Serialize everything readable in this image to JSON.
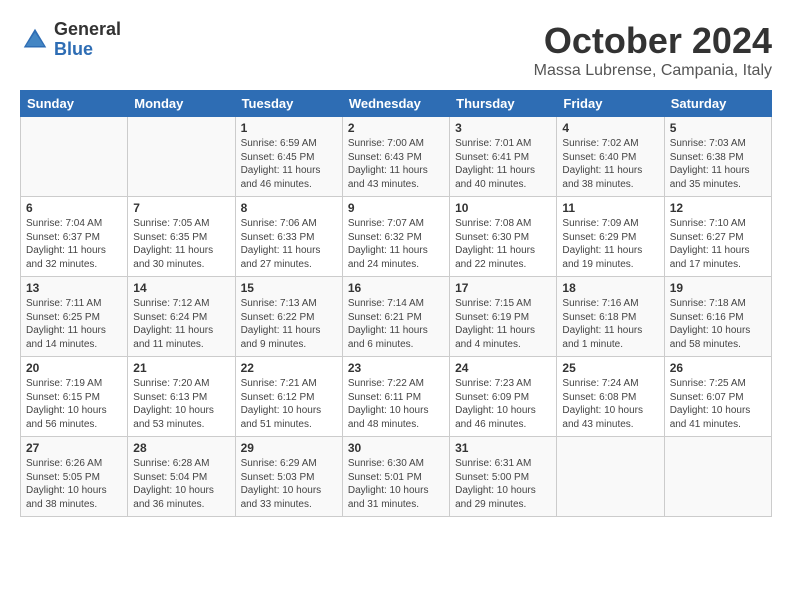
{
  "header": {
    "logo_general": "General",
    "logo_blue": "Blue",
    "title": "October 2024",
    "location": "Massa Lubrense, Campania, Italy"
  },
  "columns": [
    "Sunday",
    "Monday",
    "Tuesday",
    "Wednesday",
    "Thursday",
    "Friday",
    "Saturday"
  ],
  "weeks": [
    [
      {
        "day": "",
        "info": ""
      },
      {
        "day": "",
        "info": ""
      },
      {
        "day": "1",
        "info": "Sunrise: 6:59 AM\nSunset: 6:45 PM\nDaylight: 11 hours and 46 minutes."
      },
      {
        "day": "2",
        "info": "Sunrise: 7:00 AM\nSunset: 6:43 PM\nDaylight: 11 hours and 43 minutes."
      },
      {
        "day": "3",
        "info": "Sunrise: 7:01 AM\nSunset: 6:41 PM\nDaylight: 11 hours and 40 minutes."
      },
      {
        "day": "4",
        "info": "Sunrise: 7:02 AM\nSunset: 6:40 PM\nDaylight: 11 hours and 38 minutes."
      },
      {
        "day": "5",
        "info": "Sunrise: 7:03 AM\nSunset: 6:38 PM\nDaylight: 11 hours and 35 minutes."
      }
    ],
    [
      {
        "day": "6",
        "info": "Sunrise: 7:04 AM\nSunset: 6:37 PM\nDaylight: 11 hours and 32 minutes."
      },
      {
        "day": "7",
        "info": "Sunrise: 7:05 AM\nSunset: 6:35 PM\nDaylight: 11 hours and 30 minutes."
      },
      {
        "day": "8",
        "info": "Sunrise: 7:06 AM\nSunset: 6:33 PM\nDaylight: 11 hours and 27 minutes."
      },
      {
        "day": "9",
        "info": "Sunrise: 7:07 AM\nSunset: 6:32 PM\nDaylight: 11 hours and 24 minutes."
      },
      {
        "day": "10",
        "info": "Sunrise: 7:08 AM\nSunset: 6:30 PM\nDaylight: 11 hours and 22 minutes."
      },
      {
        "day": "11",
        "info": "Sunrise: 7:09 AM\nSunset: 6:29 PM\nDaylight: 11 hours and 19 minutes."
      },
      {
        "day": "12",
        "info": "Sunrise: 7:10 AM\nSunset: 6:27 PM\nDaylight: 11 hours and 17 minutes."
      }
    ],
    [
      {
        "day": "13",
        "info": "Sunrise: 7:11 AM\nSunset: 6:25 PM\nDaylight: 11 hours and 14 minutes."
      },
      {
        "day": "14",
        "info": "Sunrise: 7:12 AM\nSunset: 6:24 PM\nDaylight: 11 hours and 11 minutes."
      },
      {
        "day": "15",
        "info": "Sunrise: 7:13 AM\nSunset: 6:22 PM\nDaylight: 11 hours and 9 minutes."
      },
      {
        "day": "16",
        "info": "Sunrise: 7:14 AM\nSunset: 6:21 PM\nDaylight: 11 hours and 6 minutes."
      },
      {
        "day": "17",
        "info": "Sunrise: 7:15 AM\nSunset: 6:19 PM\nDaylight: 11 hours and 4 minutes."
      },
      {
        "day": "18",
        "info": "Sunrise: 7:16 AM\nSunset: 6:18 PM\nDaylight: 11 hours and 1 minute."
      },
      {
        "day": "19",
        "info": "Sunrise: 7:18 AM\nSunset: 6:16 PM\nDaylight: 10 hours and 58 minutes."
      }
    ],
    [
      {
        "day": "20",
        "info": "Sunrise: 7:19 AM\nSunset: 6:15 PM\nDaylight: 10 hours and 56 minutes."
      },
      {
        "day": "21",
        "info": "Sunrise: 7:20 AM\nSunset: 6:13 PM\nDaylight: 10 hours and 53 minutes."
      },
      {
        "day": "22",
        "info": "Sunrise: 7:21 AM\nSunset: 6:12 PM\nDaylight: 10 hours and 51 minutes."
      },
      {
        "day": "23",
        "info": "Sunrise: 7:22 AM\nSunset: 6:11 PM\nDaylight: 10 hours and 48 minutes."
      },
      {
        "day": "24",
        "info": "Sunrise: 7:23 AM\nSunset: 6:09 PM\nDaylight: 10 hours and 46 minutes."
      },
      {
        "day": "25",
        "info": "Sunrise: 7:24 AM\nSunset: 6:08 PM\nDaylight: 10 hours and 43 minutes."
      },
      {
        "day": "26",
        "info": "Sunrise: 7:25 AM\nSunset: 6:07 PM\nDaylight: 10 hours and 41 minutes."
      }
    ],
    [
      {
        "day": "27",
        "info": "Sunrise: 6:26 AM\nSunset: 5:05 PM\nDaylight: 10 hours and 38 minutes."
      },
      {
        "day": "28",
        "info": "Sunrise: 6:28 AM\nSunset: 5:04 PM\nDaylight: 10 hours and 36 minutes."
      },
      {
        "day": "29",
        "info": "Sunrise: 6:29 AM\nSunset: 5:03 PM\nDaylight: 10 hours and 33 minutes."
      },
      {
        "day": "30",
        "info": "Sunrise: 6:30 AM\nSunset: 5:01 PM\nDaylight: 10 hours and 31 minutes."
      },
      {
        "day": "31",
        "info": "Sunrise: 6:31 AM\nSunset: 5:00 PM\nDaylight: 10 hours and 29 minutes."
      },
      {
        "day": "",
        "info": ""
      },
      {
        "day": "",
        "info": ""
      }
    ]
  ]
}
